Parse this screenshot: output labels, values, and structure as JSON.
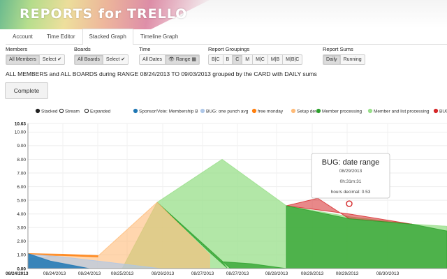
{
  "app": {
    "title": "REPORTS for TRELLO"
  },
  "tabs": [
    {
      "label": "Account",
      "active": false
    },
    {
      "label": "Time Editor",
      "active": false
    },
    {
      "label": "Stacked Graph",
      "active": true
    },
    {
      "label": "Timeline Graph",
      "active": false
    }
  ],
  "controls": {
    "members": {
      "label": "Members",
      "all": "All Members",
      "select": "Select ✔"
    },
    "boards": {
      "label": "Boards",
      "all": "All Boards",
      "select": "Select ✔"
    },
    "time": {
      "label": "Time",
      "all": "All Dates",
      "range": "👁 Range ▦"
    },
    "groupings": {
      "label": "Report Groupings",
      "options": [
        "B|C",
        "B",
        "C",
        "M",
        "M|C",
        "M|B",
        "M|B|C"
      ],
      "active": "C"
    },
    "sums": {
      "label": "Report Sums",
      "options": [
        "Daily",
        "Running"
      ],
      "active": "Daily"
    }
  },
  "summary": "ALL MEMBERS and ALL BOARDS during RANGE 08/24/2013 TO 09/03/2013 grouped by the CARD with DAILY sums",
  "complete_label": "Complete",
  "chart_data": {
    "type": "area",
    "stack_modes": [
      {
        "label": "Stacked",
        "selected": true
      },
      {
        "label": "Stream",
        "selected": false
      },
      {
        "label": "Expanded",
        "selected": false
      }
    ],
    "legend_position": "top",
    "grid": true,
    "ylim": [
      0,
      10.63
    ],
    "y_ticks": [
      "0.00",
      "1.00",
      "2.00",
      "3.00",
      "4.00",
      "5.00",
      "6.00",
      "7.00",
      "8.00",
      "9.00",
      "10.00",
      "10.63"
    ],
    "x_ticks": [
      "08/24/2013",
      "08/24/2013",
      "08/24/2013",
      "08/25/2013",
      "08/26/2013",
      "08/27/2013",
      "08/27/2013",
      "08/28/2013",
      "08/29/2013",
      "08/29/2013",
      "08/30/2013"
    ],
    "series": [
      {
        "name": "Sponsor/Vote: Membership B",
        "color": "#1f77b4"
      },
      {
        "name": "BUG: one punch avg",
        "color": "#aec7e8"
      },
      {
        "name": "free monday",
        "color": "#ff7f0e"
      },
      {
        "name": "Setup dev",
        "color": "#ffbb78"
      },
      {
        "name": "Member processing",
        "color": "#2ca02c"
      },
      {
        "name": "Member and list processing",
        "color": "#98df8a"
      },
      {
        "name": "BUG: date range",
        "color": "#d62728"
      }
    ],
    "tooltip": {
      "title": "BUG: date range",
      "date": "08/29/2013",
      "duration": "0h:31m:31",
      "decimal": "hours decimal: 0.53"
    }
  }
}
